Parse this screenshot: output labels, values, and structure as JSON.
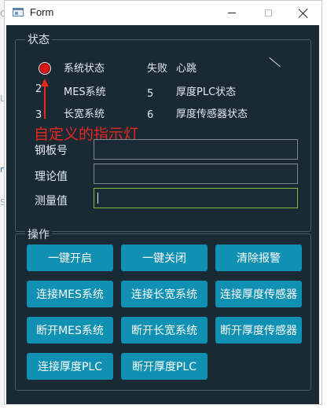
{
  "background_snippets": [
    "Cc",
    "LC",
    "ne",
    "Se"
  ],
  "window": {
    "title": "Form",
    "minimize_label": "minimize",
    "maximize_label": "maximize",
    "close_label": "close"
  },
  "status_group": {
    "title": "状态",
    "system_status_label": "系统状态",
    "system_status_value": "失败",
    "heartbeat_label": "心跳",
    "mes_num": "2",
    "mes_label": "MES系统",
    "thickness_plc_num": "5",
    "thickness_plc_label": "厚度PLC状态",
    "length_width_num": "3",
    "length_width_label": "长宽系统",
    "thickness_sensor_num": "6",
    "thickness_sensor_label": "厚度传感器状态",
    "annotation": "自定义的指示灯",
    "indicator_color": "#d61414",
    "annotation_color": "#e8271d"
  },
  "fields": {
    "plate_label": "钢板号",
    "plate_value": "",
    "theory_label": "理论值",
    "theory_value": "",
    "measured_label": "测量值",
    "measured_value": ""
  },
  "ops_group": {
    "title": "操作",
    "buttons": [
      "一键开启",
      "一键关闭",
      "清除报警",
      "连接MES系统",
      "连接长宽系统",
      "连接厚度传感器",
      "断开MES系统",
      "断开长宽系统",
      "断开厚度传感器",
      "连接厚度PLC",
      "断开厚度PLC"
    ],
    "button_color": "#1090b3"
  },
  "theme": {
    "background": "#192a35",
    "focus_border": "#86c13a"
  }
}
